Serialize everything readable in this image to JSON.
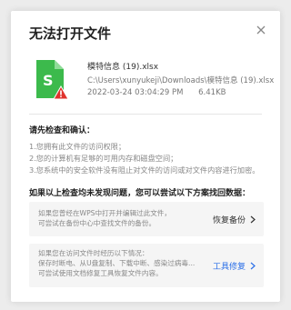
{
  "dialog": {
    "title": "无法打开文件",
    "close_icon": "close-icon"
  },
  "file": {
    "name": "模特信息 (19).xlsx",
    "path": "C:\\Users\\xunyukeji\\Downloads\\模特信息 (19).xlsx",
    "date": "2022-03-24  03:04:29 PM",
    "size": "6.41KB",
    "icon": "spreadsheet-file-icon",
    "warning_icon": "warning-icon",
    "colors": {
      "file_green": "#3cba4c",
      "warning_red": "#e0322d"
    }
  },
  "check": {
    "title": "请先检查和确认：",
    "items": [
      "1.您拥有此文件的访问权限；",
      "2.您的计算机有足够的可用内存和磁盘空间；",
      "3.您系统中的安全软件没有阻止对文件的访问或对文件内容进行加密。"
    ]
  },
  "recover": {
    "title": "如果以上检查均未发现问题，您可以尝试以下方案找回数据：",
    "cards": [
      {
        "lines": [
          "如果您曾经在WPS中打开并编辑过此文件，",
          "可尝试在备份中心中查找文件的备份。"
        ],
        "action": "恢复备份"
      },
      {
        "lines": [
          "如果您在访问文件时经历以下情况：",
          "保存时断电、从U盘复制、下载中断、感染过病毒...",
          "可尝试使用文档修复工具恢复文件内容。"
        ],
        "action": "工具修复"
      }
    ]
  },
  "colors": {
    "accent": "#2b6fe8",
    "card_bg": "#f5f5f5"
  }
}
